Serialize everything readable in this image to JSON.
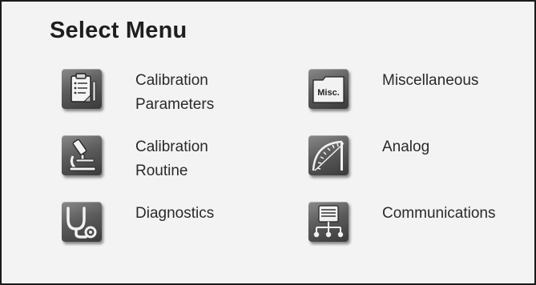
{
  "title": "Select Menu",
  "menu": {
    "calibration_parameters": {
      "line1": "Calibration",
      "line2": "Parameters",
      "icon": "clipboard-icon"
    },
    "calibration_routine": {
      "line1": "Calibration",
      "line2": "Routine",
      "icon": "microscope-icon"
    },
    "diagnostics": {
      "line1": "Diagnostics",
      "icon": "stethoscope-icon"
    },
    "miscellaneous": {
      "line1": "Miscellaneous",
      "icon": "misc-folder-icon",
      "icon_text": "Misc."
    },
    "analog": {
      "line1": "Analog",
      "icon": "gauge-icon"
    },
    "communications": {
      "line1": "Communications",
      "icon": "network-icon"
    }
  }
}
